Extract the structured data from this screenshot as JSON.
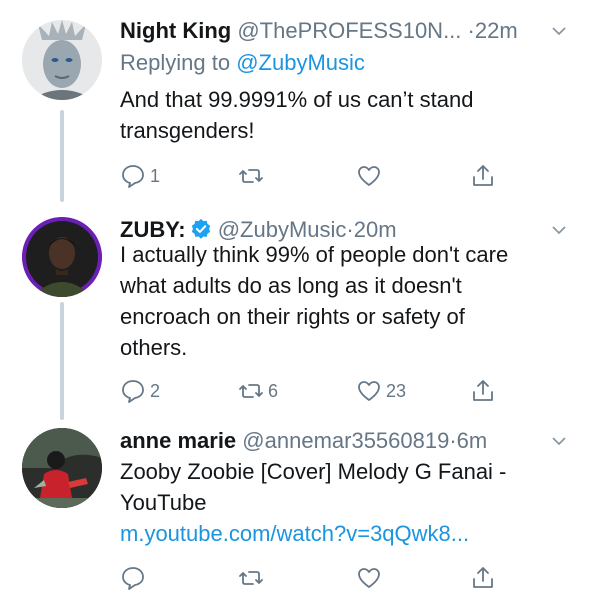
{
  "tweets": [
    {
      "name": "Night King",
      "handle": "@ThePROFESS10N...",
      "time": "22m",
      "reply_prefix": "Replying to",
      "reply_handle": "@ZubyMusic",
      "text_lines": [
        "And that 99.9991% of us can’t stand",
        "transgenders!"
      ],
      "reply_count": "1",
      "retweet_count": "",
      "like_count": ""
    },
    {
      "name": "ZUBY:",
      "handle": "@ZubyMusic",
      "time": "20m",
      "verified": true,
      "text_lines": [
        "I actually think 99% of people don't care",
        "what adults do as long as it doesn't",
        "encroach on their rights or safety of",
        "others."
      ],
      "reply_count": "2",
      "retweet_count": "6",
      "like_count": "23"
    },
    {
      "name": "anne marie",
      "handle": "@annemar35560819",
      "time": "6m",
      "text_lines": [
        "Zooby Zoobie [Cover] Melody G Fanai -",
        "YouTube"
      ],
      "link": "m.youtube.com/watch?v=3qQwk8...",
      "reply_count": "",
      "retweet_count": "",
      "like_count": ""
    }
  ],
  "separator": "·",
  "colors": {
    "link": "#1b95e0",
    "muted": "#657786",
    "verified": "#1da1f2"
  }
}
